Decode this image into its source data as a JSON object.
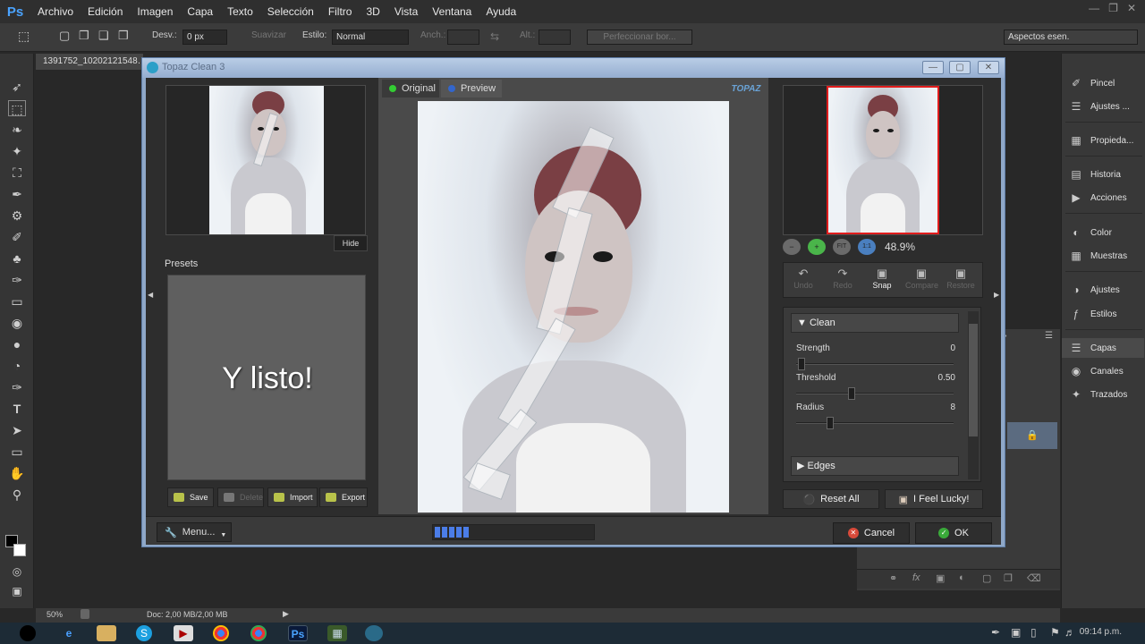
{
  "photoshop": {
    "logo": "Ps",
    "menu": [
      "Archivo",
      "Edición",
      "Imagen",
      "Capa",
      "Texto",
      "Selección",
      "Filtro",
      "3D",
      "Vista",
      "Ventana",
      "Ayuda"
    ],
    "options": {
      "desvanecer_label": "Desv.:",
      "desvanecer_value": "0 px",
      "suavizar_label": "Suavizar",
      "estilo_label": "Estilo:",
      "estilo_value": "Normal",
      "anchura_label": "Anch.:",
      "altura_label": "Alt.:",
      "perfeccionar_label": "Perfeccionar bor...",
      "workspace_value": "Aspectos esen."
    },
    "document_tab": "1391752_10202121548…",
    "status": {
      "zoom": "50%",
      "doc": "Doc: 2,00 MB/2,00 MB"
    },
    "panels": [
      {
        "label": "Pincel",
        "icon": "brush-icon"
      },
      {
        "label": "Ajustes ...",
        "icon": "brush-settings-icon"
      },
      {
        "label": "Propieda...",
        "icon": "properties-icon"
      },
      {
        "label": "Historia",
        "icon": "history-icon"
      },
      {
        "label": "Acciones",
        "icon": "play-icon"
      },
      {
        "label": "Color",
        "icon": "color-icon"
      },
      {
        "label": "Muestras",
        "icon": "swatches-icon"
      },
      {
        "label": "Ajustes",
        "icon": "adjustments-icon"
      },
      {
        "label": "Estilos",
        "icon": "styles-icon"
      },
      {
        "label": "Capas",
        "icon": "layers-icon"
      },
      {
        "label": "Canales",
        "icon": "channels-icon"
      },
      {
        "label": "Trazados",
        "icon": "paths-icon"
      }
    ],
    "clock": "09:14 p.m."
  },
  "dialog": {
    "title": "Topaz Clean 3",
    "hide_label": "Hide",
    "presets_label": "Presets",
    "overlay_text": "Y listo!",
    "preset_buttons": {
      "save": "Save",
      "delete": "Delete",
      "import": "Import",
      "export": "Export"
    },
    "tabs": {
      "original": "Original",
      "preview": "Preview"
    },
    "brand": "TOPAZ",
    "zoom_value": "48.9%",
    "toolbar": {
      "undo": "Undo",
      "redo": "Redo",
      "snap": "Snap",
      "compare": "Compare",
      "restore": "Restore"
    },
    "clean": {
      "section": "Clean",
      "strength_label": "Strength",
      "strength_value": "0",
      "threshold_label": "Threshold",
      "threshold_value": "0.50",
      "radius_label": "Radius",
      "radius_value": "8",
      "edges_section": "Edges"
    },
    "reset_all": "Reset All",
    "feel_lucky": "I Feel Lucky!",
    "menu_label": "Menu...",
    "progress": 0.22,
    "cancel": "Cancel",
    "ok": "OK"
  }
}
